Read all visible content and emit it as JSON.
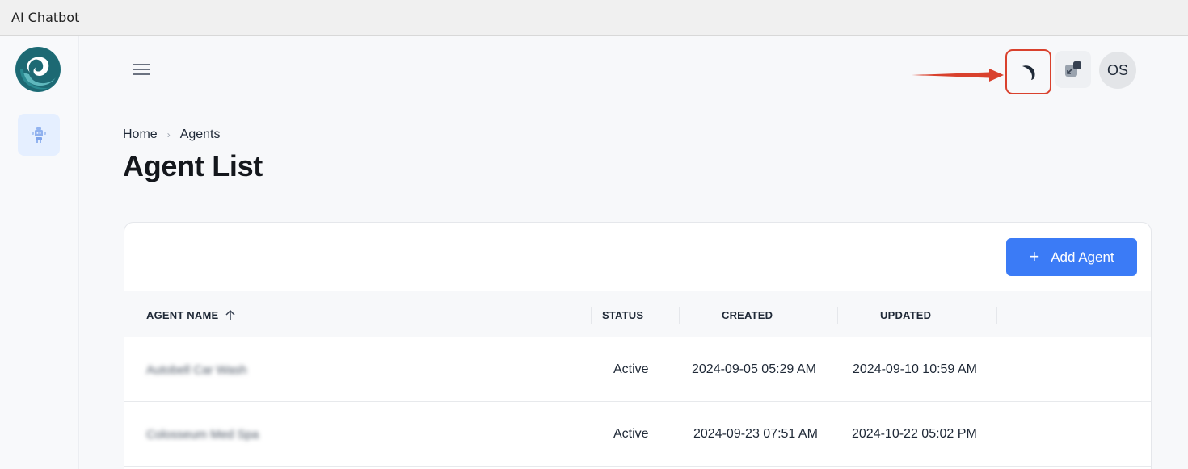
{
  "window": {
    "title": "AI Chatbot"
  },
  "breadcrumb": {
    "home": "Home",
    "separator": "›",
    "current": "Agents"
  },
  "page": {
    "title": "Agent List"
  },
  "header": {
    "avatar_initials": "OS"
  },
  "toolbar": {
    "add_label": "Add Agent",
    "add_icon": "+"
  },
  "table": {
    "columns": [
      {
        "label": "AGENT NAME",
        "sort": "ascending"
      },
      {
        "label": "STATUS"
      },
      {
        "label": "CREATED"
      },
      {
        "label": "UPDATED"
      }
    ],
    "rows": [
      {
        "name": "Autobell Car Wash",
        "status": "Active",
        "created": "2024-09-05 05:29 AM",
        "updated": "2024-09-10 10:59 AM"
      },
      {
        "name": "Colosseum Med Spa",
        "status": "Active",
        "created": "2024-09-23 07:51 AM",
        "updated": "2024-10-22 05:02 PM"
      }
    ]
  },
  "colors": {
    "accent": "#3b7bf6",
    "highlight": "#d9412d",
    "logo_teal": "#1e6e78"
  },
  "icons": {
    "logo": "swirl-logo",
    "sidebar_agents": "robot-icon",
    "menu": "hamburger-icon",
    "theme": "moon-icon",
    "fullscreen": "exit-fullscreen-icon",
    "sort": "arrow-up-icon"
  }
}
